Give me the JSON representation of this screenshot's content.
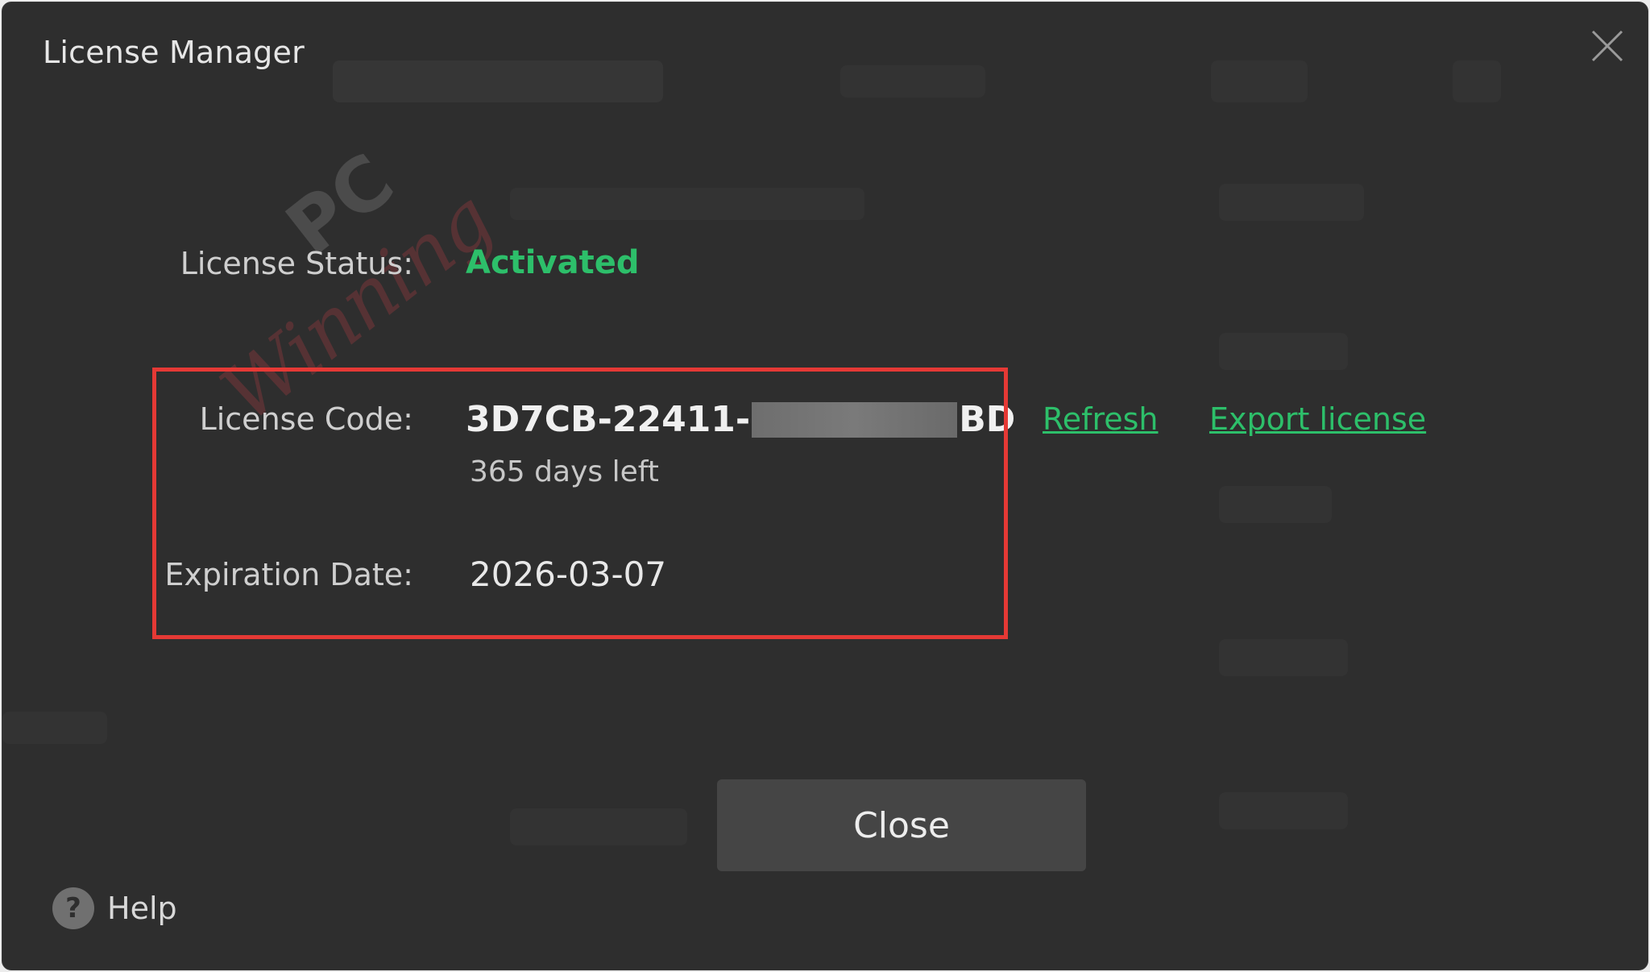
{
  "window": {
    "title": "License Manager"
  },
  "license": {
    "status_label": "License Status:",
    "status_value": "Activated",
    "code_label": "License Code:",
    "code_prefix": "3D7CB-22411-",
    "code_suffix": "BD",
    "days_left": "365 days left",
    "expiration_label": "Expiration Date:",
    "expiration_value": "2026-03-07"
  },
  "actions": {
    "refresh": "Refresh",
    "export": "Export license",
    "close": "Close",
    "help": "Help",
    "help_glyph": "?"
  },
  "watermark": {
    "brand": "PC",
    "script": "Winning"
  },
  "colors": {
    "background": "#2e2e2e",
    "accent_green": "#2dbf6a",
    "highlight_red": "#e53935",
    "button": "#454545"
  },
  "icons": {
    "close": "close-icon",
    "help": "help-icon"
  }
}
